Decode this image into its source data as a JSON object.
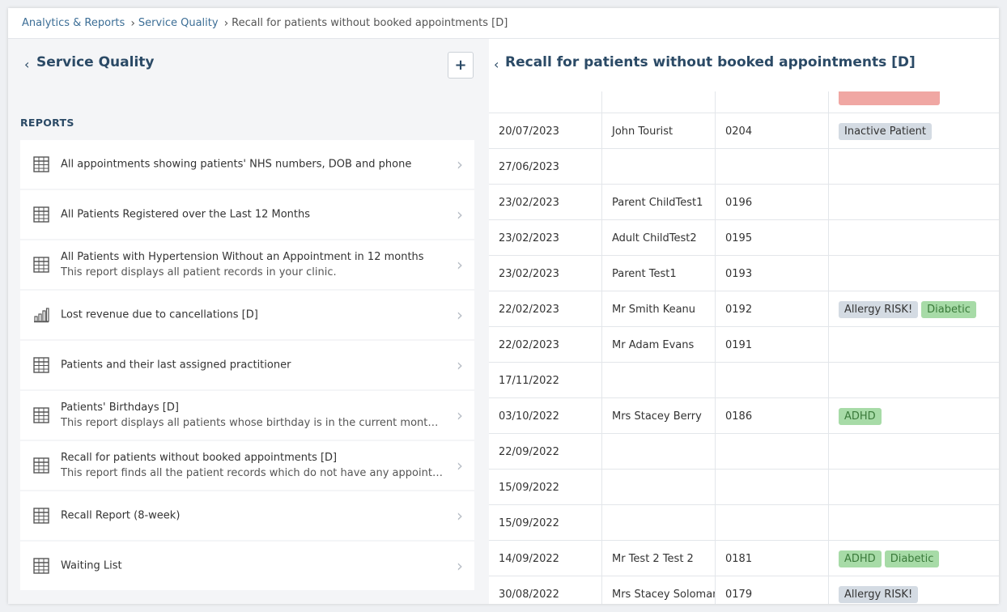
{
  "breadcrumb": {
    "items": [
      "Analytics & Reports",
      "Service Quality"
    ],
    "current": "Recall for patients without booked appointments [D]"
  },
  "left_panel": {
    "title": "Service Quality",
    "add_label": "+",
    "section_label": "REPORTS",
    "reports": [
      {
        "icon": "table-icon",
        "title": "All appointments showing patients' NHS numbers, DOB and phone",
        "desc": ""
      },
      {
        "icon": "table-icon",
        "title": "All Patients Registered over the Last 12 Months",
        "desc": ""
      },
      {
        "icon": "table-icon",
        "title": "All Patients with Hypertension Without an Appointment in 12 months",
        "desc": "This report displays all patient records in your clinic."
      },
      {
        "icon": "bar-chart-icon",
        "title": "Lost revenue due to cancellations [D]",
        "desc": ""
      },
      {
        "icon": "table-icon",
        "title": "Patients and their last assigned practitioner",
        "desc": ""
      },
      {
        "icon": "table-icon",
        "title": "Patients' Birthdays [D]",
        "desc": "This report displays all patients whose birthday is in the current month. You..."
      },
      {
        "icon": "table-icon",
        "title": "Recall for patients without booked appointments [D]",
        "desc": "This report finds all the patient records which do not have any appointment..."
      },
      {
        "icon": "table-icon",
        "title": "Recall Report (8-week)",
        "desc": ""
      },
      {
        "icon": "table-icon",
        "title": "Waiting List",
        "desc": ""
      }
    ]
  },
  "right_panel": {
    "title": "Recall for patients without booked appointments [D]",
    "rows": [
      {
        "date": "",
        "name": "",
        "id": "",
        "tags": [
          {
            "label": "",
            "color": "pink"
          }
        ]
      },
      {
        "date": "20/07/2023",
        "name": "John Tourist",
        "id": "0204",
        "tags": [
          {
            "label": "Inactive Patient",
            "color": "gray"
          }
        ]
      },
      {
        "date": "27/06/2023",
        "name": "",
        "id": "",
        "tags": []
      },
      {
        "date": "23/02/2023",
        "name": "Parent ChildTest1",
        "id": "0196",
        "tags": []
      },
      {
        "date": "23/02/2023",
        "name": "Adult ChildTest2",
        "id": "0195",
        "tags": []
      },
      {
        "date": "23/02/2023",
        "name": "Parent Test1",
        "id": "0193",
        "tags": []
      },
      {
        "date": "22/02/2023",
        "name": "Mr Smith Keanu",
        "id": "0192",
        "tags": [
          {
            "label": "Allergy RISK!",
            "color": "gray"
          },
          {
            "label": "Diabetic",
            "color": "green"
          }
        ]
      },
      {
        "date": "22/02/2023",
        "name": "Mr Adam Evans",
        "id": "0191",
        "tags": []
      },
      {
        "date": "17/11/2022",
        "name": "",
        "id": "",
        "tags": []
      },
      {
        "date": "03/10/2022",
        "name": "Mrs Stacey Berry",
        "id": "0186",
        "tags": [
          {
            "label": "ADHD",
            "color": "green"
          }
        ]
      },
      {
        "date": "22/09/2022",
        "name": "",
        "id": "",
        "tags": []
      },
      {
        "date": "15/09/2022",
        "name": "",
        "id": "",
        "tags": []
      },
      {
        "date": "15/09/2022",
        "name": "",
        "id": "",
        "tags": []
      },
      {
        "date": "14/09/2022",
        "name": "Mr Test 2 Test 2",
        "id": "0181",
        "tags": [
          {
            "label": "ADHD",
            "color": "green"
          },
          {
            "label": "Diabetic",
            "color": "green"
          }
        ]
      },
      {
        "date": "30/08/2022",
        "name": "Mrs Stacey Soloman",
        "id": "0179",
        "tags": [
          {
            "label": "Allergy RISK!",
            "color": "gray"
          }
        ]
      }
    ]
  },
  "colors": {
    "title": "#2b4a66",
    "link": "#3c6e96",
    "tag_gray": "#d4dbe3",
    "tag_green": "#a7dba7",
    "tag_pink": "#f0a7a3"
  }
}
